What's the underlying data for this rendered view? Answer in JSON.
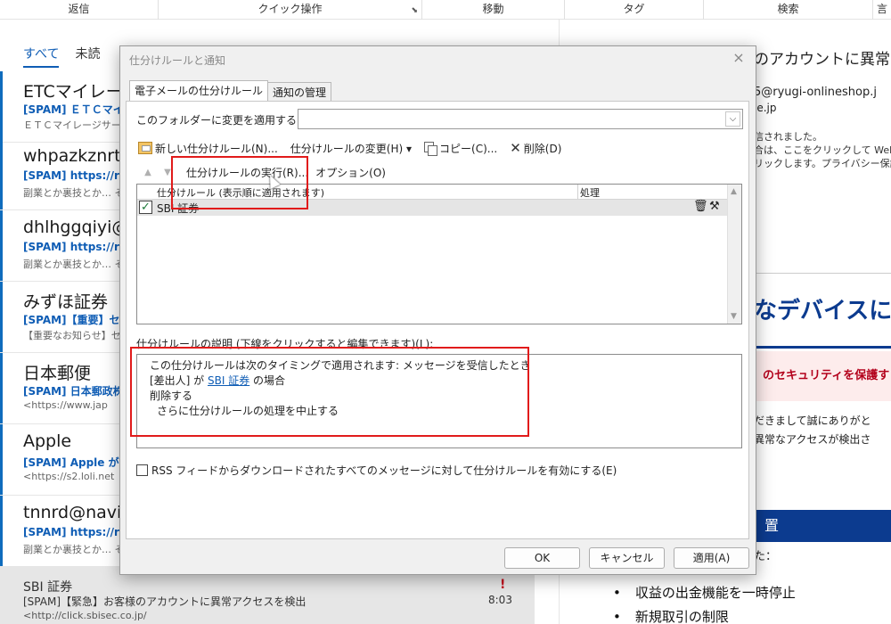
{
  "ribbon": {
    "groups": [
      {
        "label": "返信"
      },
      {
        "label": "クイック操作"
      },
      {
        "label": "移動"
      },
      {
        "label": "タグ"
      },
      {
        "label": "検索"
      },
      {
        "label": "言"
      }
    ]
  },
  "maillist": {
    "tabs": [
      {
        "label": "すべて"
      },
      {
        "label": "未読"
      }
    ],
    "items": [
      {
        "sender": "ETCマイレージ",
        "subject": "[SPAM] ＥＴＣマイ",
        "preview": "ＥＴＣマイレージサービ"
      },
      {
        "sender": "whpazkznrt",
        "subject": "[SPAM] https://r",
        "preview": "副業とか裏技とか… そ"
      },
      {
        "sender": "dhlhggqiyi@",
        "subject": "[SPAM] https://r",
        "preview": "副業とか裏技とか… そ"
      },
      {
        "sender": "みずほ証券",
        "subject": "[SPAM]【重要】セキ",
        "preview": "【重要なお知らせ】セキ"
      },
      {
        "sender": "日本郵便",
        "subject": "[SPAM] 日本郵政株",
        "preview": "<https://www.jap"
      },
      {
        "sender": "Apple",
        "subject": "[SPAM] Apple が",
        "preview": "<https://s2.loli.net"
      },
      {
        "sender": "tnnrd@navi",
        "subject": "[SPAM] https://r",
        "preview": "副業とか裏技とか… そ"
      }
    ],
    "selected": {
      "sender": "SBI 証券",
      "subject": "[SPAM]【緊急】お客様のアカウントに異常アクセスを検出",
      "preview": "<http://click.sbisec.co.jp/",
      "time": "8:03",
      "flag": "!"
    }
  },
  "reading": {
    "title": "のアカウントに異常ア",
    "from": "5@ryugi-onlineshop.j",
    "domain": "le.jp",
    "info": [
      "信されました。",
      "合は、ここをクリックして Web ブラウ",
      "リックします。プライバシー保護を促進"
    ],
    "headline": "なデバイスに",
    "alert": "のセキュリティを保護す",
    "body": [
      "だきまして誠にありがと",
      "異常なアクセスが検出さ"
    ],
    "banner": "置",
    "sub": "た：",
    "bullets": [
      "収益の出金機能を一時停止",
      "新規取引の制限"
    ]
  },
  "dialog": {
    "title": "仕分けルールと通知",
    "close": "×",
    "tabs": [
      {
        "label": "電子メールの仕分けルール"
      },
      {
        "label": "通知の管理"
      }
    ],
    "folder_label": "このフォルダーに変更を適用する(F):",
    "folder_value": "",
    "toolbar": {
      "new_rule": "新しい仕分けルール(N)...",
      "change_rule": "仕分けルールの変更(H) ▾",
      "copy": "コピー(C)...",
      "delete": "削除(D)",
      "run_rules": "仕分けルールの実行(R)...",
      "options": "オプション(O)",
      "move_up": "▲",
      "move_down": "▼"
    },
    "rules_list": {
      "col_rule": "仕分けルール (表示順に適用されます)",
      "col_action": "処理",
      "rows": [
        {
          "name": "SBI 証券",
          "checked": "✓"
        }
      ]
    },
    "description_label": "仕分けルールの説明 (下線をクリックすると編集できます)(L):",
    "description": {
      "line1": "この仕分けルールは次のタイミングで適用されます: メッセージを受信したとき",
      "line2_prefix": "[差出人] が ",
      "line2_link": "SBI 証券",
      "line2_suffix": " の場合",
      "line3": "削除する",
      "line4": "さらに仕分けルールの処理を中止する"
    },
    "rss_label": "RSS フィードからダウンロードされたすべてのメッセージに対して仕分けルールを有効にする(E)",
    "buttons": {
      "ok": "OK",
      "cancel": "キャンセル",
      "apply": "適用(A)"
    }
  },
  "colors": {
    "accent": "#0f5db5",
    "annotation": "#e11b1b",
    "headline": "#0c3b8f"
  }
}
